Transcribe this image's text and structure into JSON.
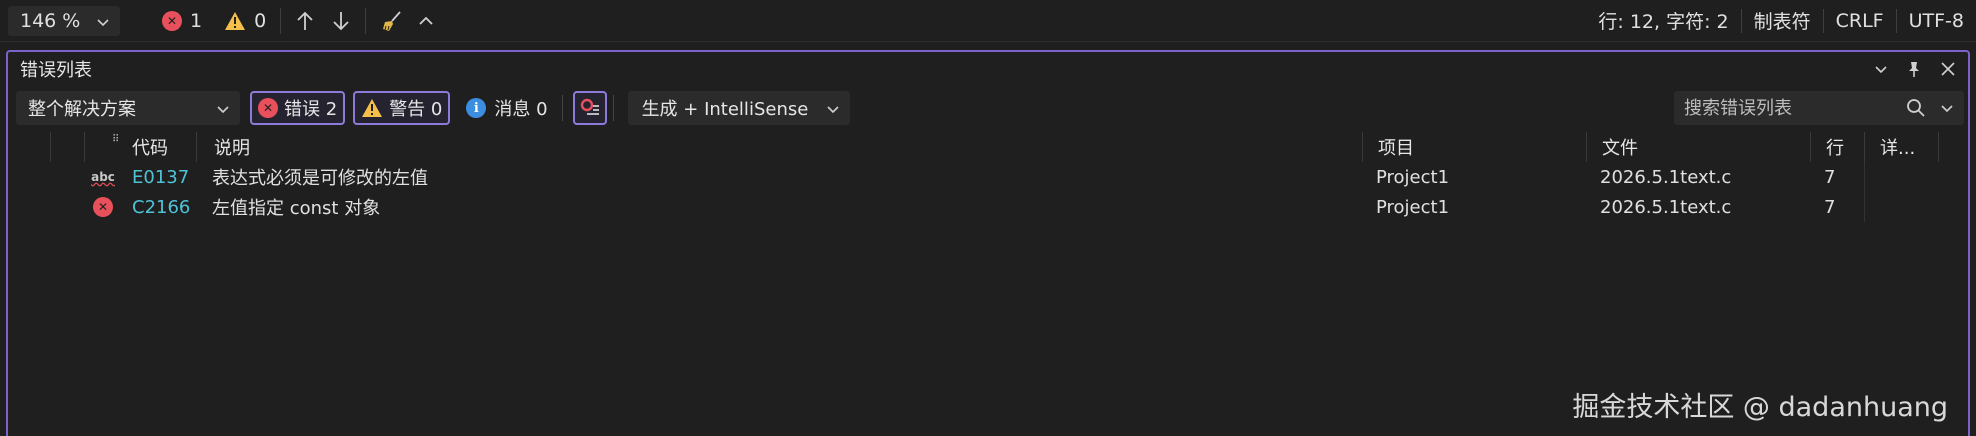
{
  "status_bar": {
    "zoom": "146 %",
    "error_count": "1",
    "warning_count": "0",
    "position": "行: 12, 字符: 2",
    "indent": "制表符",
    "line_ending": "CRLF",
    "encoding": "UTF-8"
  },
  "panel": {
    "title": "错误列表",
    "scope": "整个解决方案",
    "errors_label": "错误 2",
    "warnings_label": "警告 0",
    "messages_label": "消息 0",
    "build_filter": "生成 + IntelliSense",
    "search_placeholder": "搜索错误列表"
  },
  "table": {
    "headers": {
      "code": "代码",
      "description": "说明",
      "project": "项目",
      "file": "文件",
      "line": "行",
      "details": "详..."
    },
    "rows": [
      {
        "icon": "spell-abc-icon",
        "code": "E0137",
        "description": "表达式必须是可修改的左值",
        "project": "Project1",
        "file": "2026.5.1text.c",
        "line": "7"
      },
      {
        "icon": "error-circle-icon",
        "code": "C2166",
        "description": "左值指定 const 对象",
        "project": "Project1",
        "file": "2026.5.1text.c",
        "line": "7"
      }
    ]
  },
  "watermark": "掘金技术社区 @ dadanhuang",
  "colors": {
    "accent": "#7d62c9",
    "error": "#e8505b",
    "warning": "#f5c04a",
    "info": "#3c8fe0",
    "link": "#4ec3d6"
  }
}
